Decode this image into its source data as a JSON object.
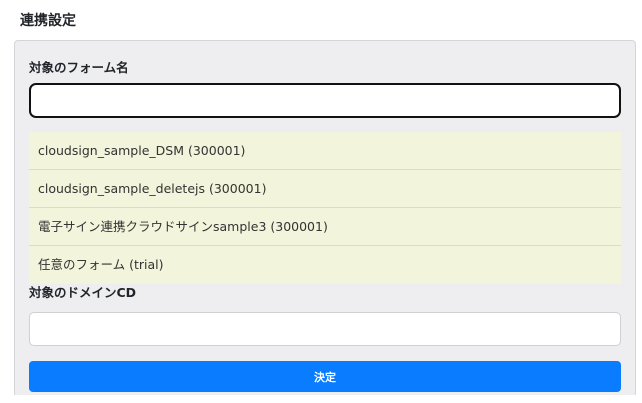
{
  "header": {
    "title": "連携設定"
  },
  "form_section": {
    "label": "対象のフォーム名",
    "search_value": "",
    "suggestions": [
      "cloudsign_sample_DSM (300001)",
      "cloudsign_sample_deletejs (300001)",
      "電子サイン連携クラウドサインsample3 (300001)",
      "任意のフォーム (trial)"
    ]
  },
  "domain_section": {
    "label": "対象のドメインCD",
    "value": ""
  },
  "actions": {
    "submit_label": "決定"
  },
  "colors": {
    "primary_button": "#0a7cff",
    "suggestion_background": "#f2f4db",
    "panel_background": "#eeeef0"
  }
}
